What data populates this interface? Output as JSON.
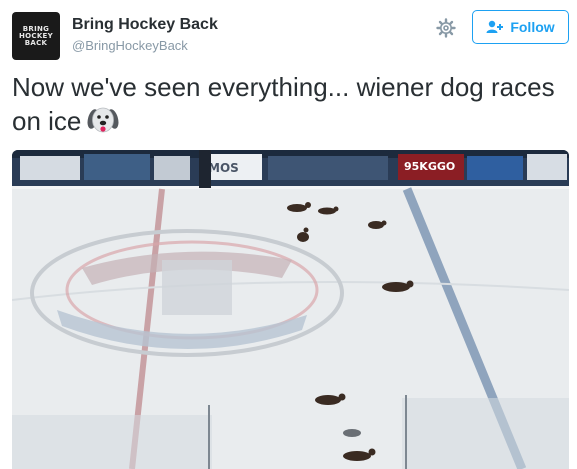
{
  "author": {
    "avatar_text": "BRING HOCKEY BACK",
    "display_name": "Bring Hockey Back",
    "handle": "@BringHockeyBack"
  },
  "actions": {
    "settings_icon": "gear-icon",
    "follow_label": "Follow",
    "follow_icon": "add-user-icon"
  },
  "tweet": {
    "text": "Now we've seen everything... wiener dog races on ice",
    "emoji": "dog-face-emoji"
  },
  "media": {
    "scoreboard_text": "95KGGO",
    "board_text": "MOS",
    "colors": {
      "ice": "#e9ecee",
      "red_line": "#c9a2a6",
      "blue_line": "#8fa4bd",
      "boards": "#2a3c56",
      "accent": "#1da1f2"
    }
  }
}
